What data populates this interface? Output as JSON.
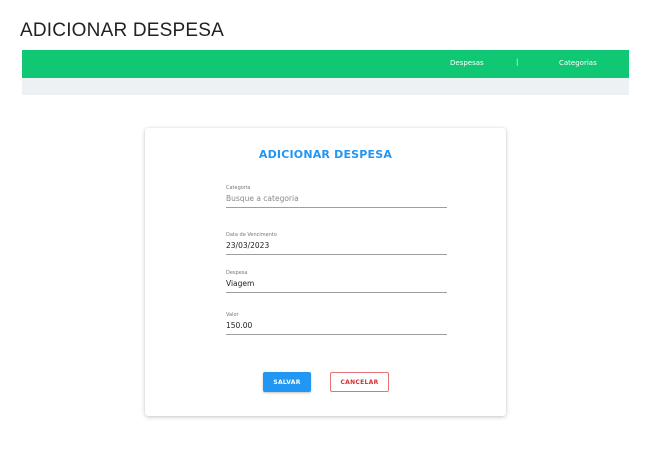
{
  "page": {
    "heading": "ADICIONAR DESPESA"
  },
  "navbar": {
    "links": [
      "Despesas",
      "Categorias"
    ],
    "separator": "|",
    "color": "#10c874"
  },
  "form": {
    "title": "ADICIONAR DESPESA",
    "title_color": "#2196f3",
    "fields": {
      "categoria": {
        "label": "Categoria",
        "value": "",
        "placeholder": "Busque a categoria"
      },
      "vencimento": {
        "label": "Data de Vencimento",
        "value": "23/03/2023"
      },
      "despesa": {
        "label": "Despesa",
        "value": "Viagem"
      },
      "valor": {
        "label": "Valor",
        "value": "150.00"
      }
    },
    "buttons": {
      "save": "SALVAR",
      "cancel": "CANCELAR"
    }
  }
}
